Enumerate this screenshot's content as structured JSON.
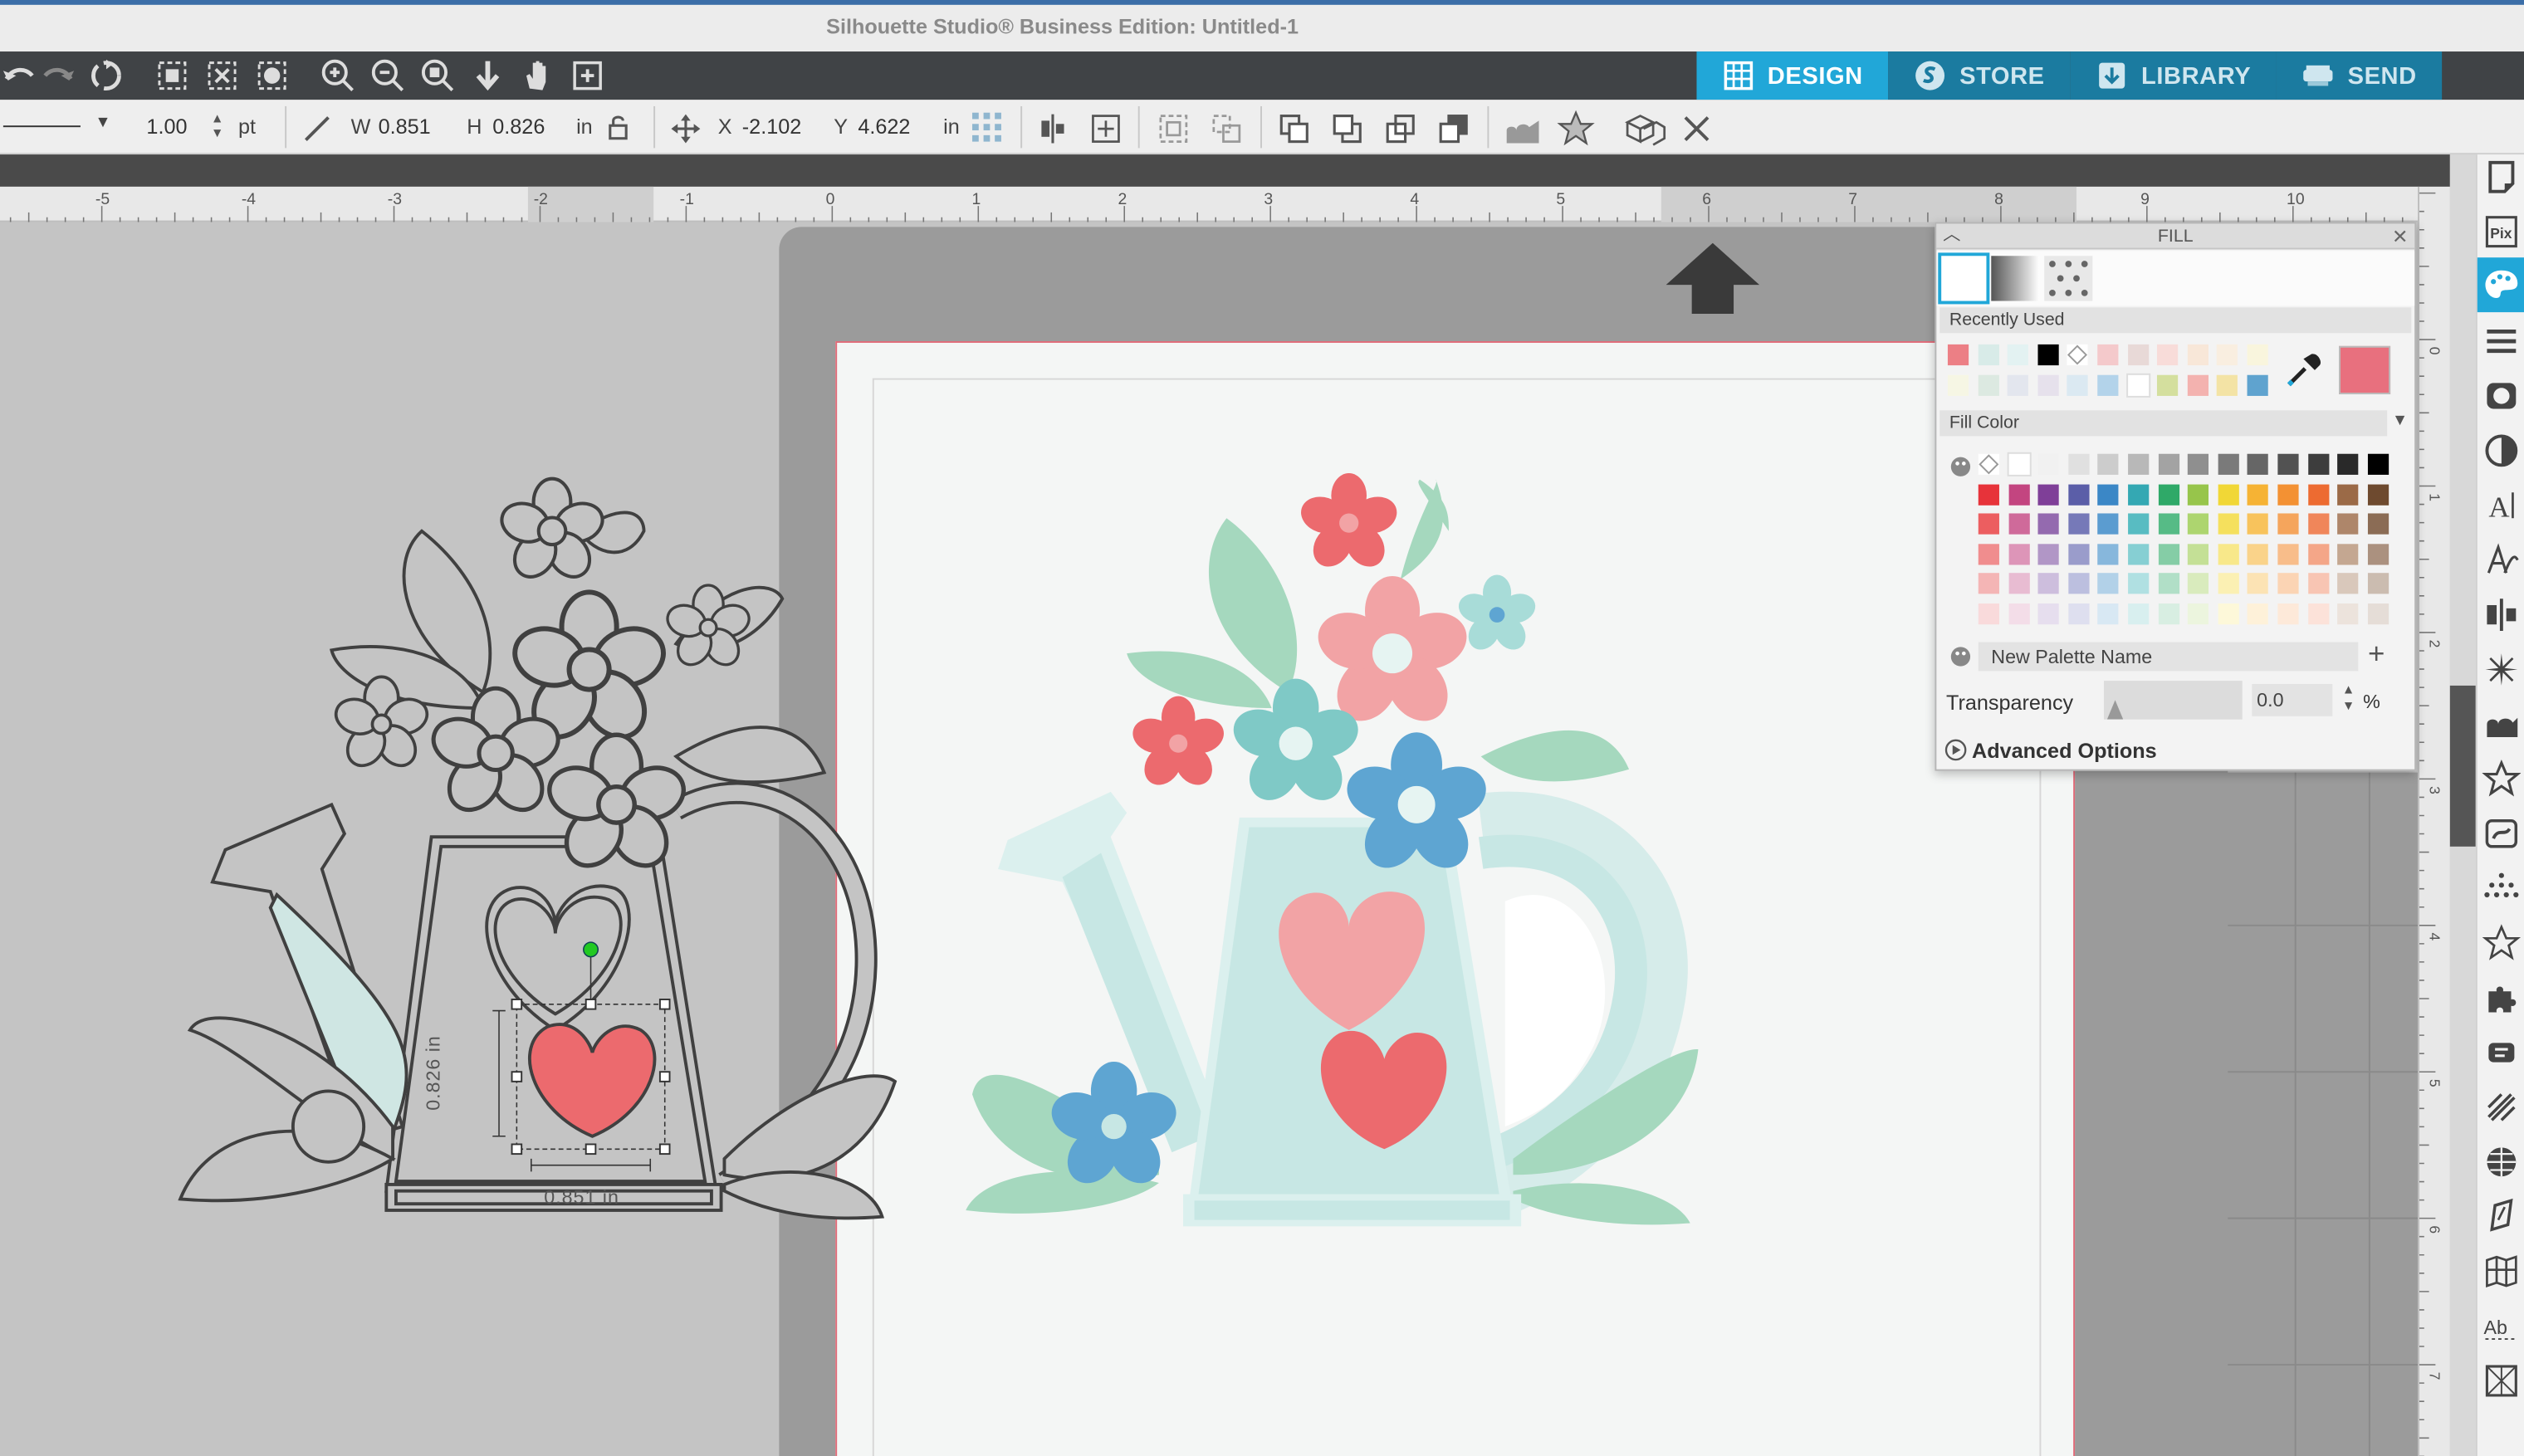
{
  "window": {
    "title": "Silhouette Studio® Business Edition: Untitled-1"
  },
  "tabs": [
    {
      "label": "DESIGN",
      "icon": "design-grid-icon"
    },
    {
      "label": "STORE",
      "icon": "store-s-icon"
    },
    {
      "label": "LIBRARY",
      "icon": "library-download-icon"
    },
    {
      "label": "SEND",
      "icon": "send-cutter-icon"
    }
  ],
  "line_style": {
    "weight": "1.00",
    "unit": "pt"
  },
  "size": {
    "w_label": "W",
    "w_value": "0.851",
    "h_label": "H",
    "h_value": "0.826",
    "unit": "in"
  },
  "position": {
    "x_label": "X",
    "x_value": "-2.102",
    "y_label": "Y",
    "y_value": "4.622",
    "unit": "in"
  },
  "ruler_h": [
    "-5",
    "-4",
    "-3",
    "-2",
    "-1",
    "0",
    "1",
    "2",
    "3",
    "4",
    "5",
    "6",
    "7",
    "8",
    "9",
    "10"
  ],
  "ruler_v": [
    "0",
    "1",
    "2",
    "3",
    "4",
    "5",
    "6",
    "7"
  ],
  "selection": {
    "width_label": "0.851 in",
    "height_label": "0.826 in"
  },
  "fill_panel": {
    "title": "FILL",
    "recently_used_label": "Recently Used",
    "fill_color_label": "Fill Color",
    "palette_name_placeholder": "New Palette Name",
    "transparency_label": "Transparency",
    "transparency_value": "0.0",
    "transparency_unit": "%",
    "advanced_label": "Advanced Options",
    "current_color": "#e8707e"
  },
  "recent_colors": [
    [
      "#ec7f85",
      "#d8ebe8",
      "#e3f2f2",
      "#000000",
      "none",
      "#f4c9cb",
      "#e8d9d7",
      "#f8dcd9",
      "#f8e7d8",
      "#f9eee0",
      "#f9f5dd"
    ],
    [
      "#f6f6e4",
      "#dce9e1",
      "#e3e6ee",
      "#e6e1ec",
      "#dbe9f2",
      "#b3d3ea",
      "#ffffff",
      "#d4df9e",
      "#f3b2af",
      "#f3e3a5",
      "#5fa3cf"
    ]
  ],
  "color_grid": [
    [
      "none",
      "#ffffff",
      "#f1f1f1",
      "#e0e0e0",
      "#cccccc",
      "#b8b8b8",
      "#a3a3a3",
      "#8f8f8f",
      "#7a7a7a",
      "#666666",
      "#525252",
      "#3d3d3d",
      "#292929",
      "#000000"
    ],
    [
      "#e7333a",
      "#c34580",
      "#7f3f98",
      "#5b5ea8",
      "#3b87c6",
      "#34a8b3",
      "#2fa968",
      "#97c54b",
      "#f1d736",
      "#f6b334",
      "#f39133",
      "#ed6b31",
      "#9b6a47",
      "#6e4a2f"
    ],
    [
      "#ec5e60",
      "#cf6a9a",
      "#946aaf",
      "#7679b8",
      "#5b9cd0",
      "#58bcc2",
      "#56bb86",
      "#add56f",
      "#f5e05d",
      "#f8c35c",
      "#f5a55c",
      "#f0865a",
      "#ae866a",
      "#8b6c55"
    ],
    [
      "#f08d8e",
      "#dd95b8",
      "#b196c6",
      "#9a9ccb",
      "#87b7dc",
      "#86cfd3",
      "#85cda6",
      "#c4e096",
      "#f8e88a",
      "#fad38a",
      "#f8bd8a",
      "#f4a688",
      "#c4a791",
      "#ab917f"
    ],
    [
      "#f4b5b5",
      "#e8bcd2",
      "#cdbedd",
      "#bcbfdf",
      "#b2d1e8",
      "#b0e0e2",
      "#b1dfc7",
      "#d9ebbd",
      "#fbf0b3",
      "#fce3b4",
      "#fbd4b4",
      "#f8c5b3",
      "#d9c8bb",
      "#cbbcb0"
    ],
    [
      "#f9dadb",
      "#f3dde8",
      "#e6deee",
      "#dedfef",
      "#d8e8f3",
      "#d8efef",
      "#d8eee2",
      "#ecf5de",
      "#fdf8d9",
      "#fef1d9",
      "#fde9d9",
      "#fce2d9",
      "#ece3dc",
      "#e5ddd7"
    ]
  ]
}
